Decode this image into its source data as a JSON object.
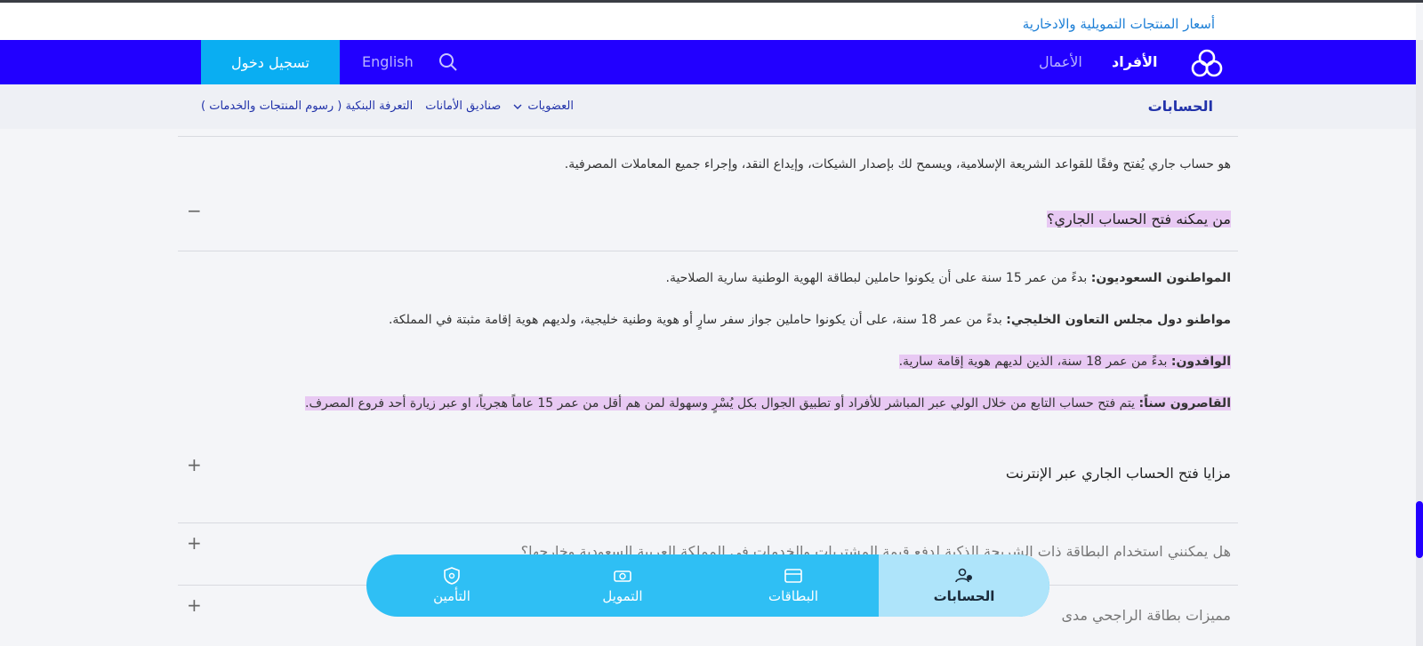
{
  "top_link": "أسعار المنتجات التمويلية والادخارية",
  "navbar": {
    "individuals": "الأفراد",
    "business": "الأعمال",
    "language": "English",
    "login": "تسجيل دخول"
  },
  "subnav": {
    "title": "الحسابات",
    "links": [
      "العضويات",
      "صناديق الأمانات",
      "التعرفة البنكية ( رسوم المنتجات والخدمات )"
    ]
  },
  "content": {
    "intro": "هو حساب جاري يُفتح وفقًا للقواعد الشريعة الإسلامية، ويسمح لك بإصدار الشيكات، وإيداع النقد، وإجراء جميع المعاملات المصرفية.",
    "q1": "من يمكنه فتح الحساب الجاري؟",
    "q1_toggle": "−",
    "items": [
      {
        "label": "المواطنون السعوديون:",
        "text": " بدءً من عمر 15 سنة على أن يكونوا حاملين لبطاقة الهوية الوطنية سارية الصلاحية."
      },
      {
        "label": "مواطنو دول مجلس التعاون الخليجي:",
        "text": " بدءً من عمر 18 سنة، على أن يكونوا حاملين جواز سفر سارٍ أو هوية وطنية خليجية، ولديهم هوية إقامة مثبتة في المملكة."
      },
      {
        "label": "الوافدون:",
        "text": " بدءً من عمر 18 سنة، الذين لديهم هوية إقامة سارية."
      },
      {
        "label": "القاصرون سناً:",
        "text": " يتم فتح حساب التابع من خلال الولي عبر المباشر للأفراد أو تطبيق الجوال بكل يُسْرٍ وسهولة لمن هم أقل من عمر 15 عاماً هجرياً، او عبر زيارة أحد فروع المصرف."
      }
    ],
    "q2": "مزايا فتح الحساب الجاري عبر الإنترنت",
    "q3": "هل يمكنني استخدام البطاقة ذات الشريحة الذكية لدفع قيمة المشتريات والخدمات في المملكة العربية السعودية وخارجها؟",
    "q4": "مميزات بطاقة الراجحي مدى",
    "plus": "+"
  },
  "dock": {
    "accounts": "الحسابات",
    "cards": "البطاقات",
    "finance": "التمويل",
    "insurance": "التأمين"
  }
}
